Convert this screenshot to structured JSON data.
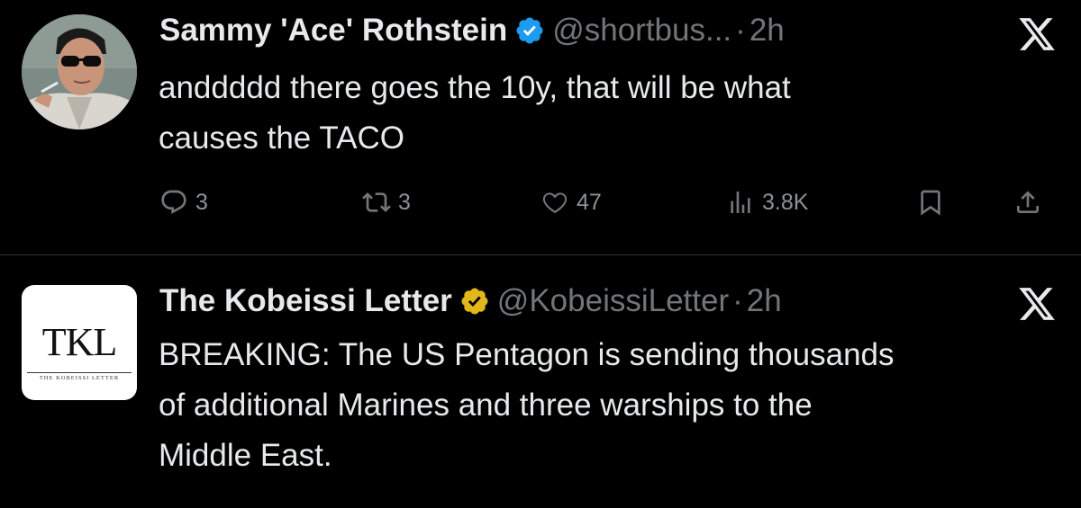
{
  "tweets": [
    {
      "author": {
        "name": "Sammy 'Ace' Rothstein",
        "handle": "@shortbus...",
        "badge_color": "#1d9bf0"
      },
      "separator": "·",
      "time": "2h",
      "brand_icon": "x-logo-icon",
      "text_lines": [
        "anddddd there goes the 10y, that will be what",
        "causes the TACO"
      ],
      "actions": {
        "replies": "3",
        "reposts": "3",
        "likes": "47",
        "views": "3.8K"
      }
    },
    {
      "author": {
        "name": "The Kobeissi Letter",
        "handle": "@KobeissiLetter",
        "badge_color": "#e2b719",
        "avatar_logo_text": "TKL",
        "avatar_logo_subtext": "THE KOBEISSI LETTER"
      },
      "separator": "·",
      "time": "2h",
      "brand_icon": "x-logo-icon",
      "text_lines": [
        "BREAKING: The US Pentagon is sending thousands",
        "of additional Marines and three warships to the",
        "Middle East."
      ]
    }
  ]
}
